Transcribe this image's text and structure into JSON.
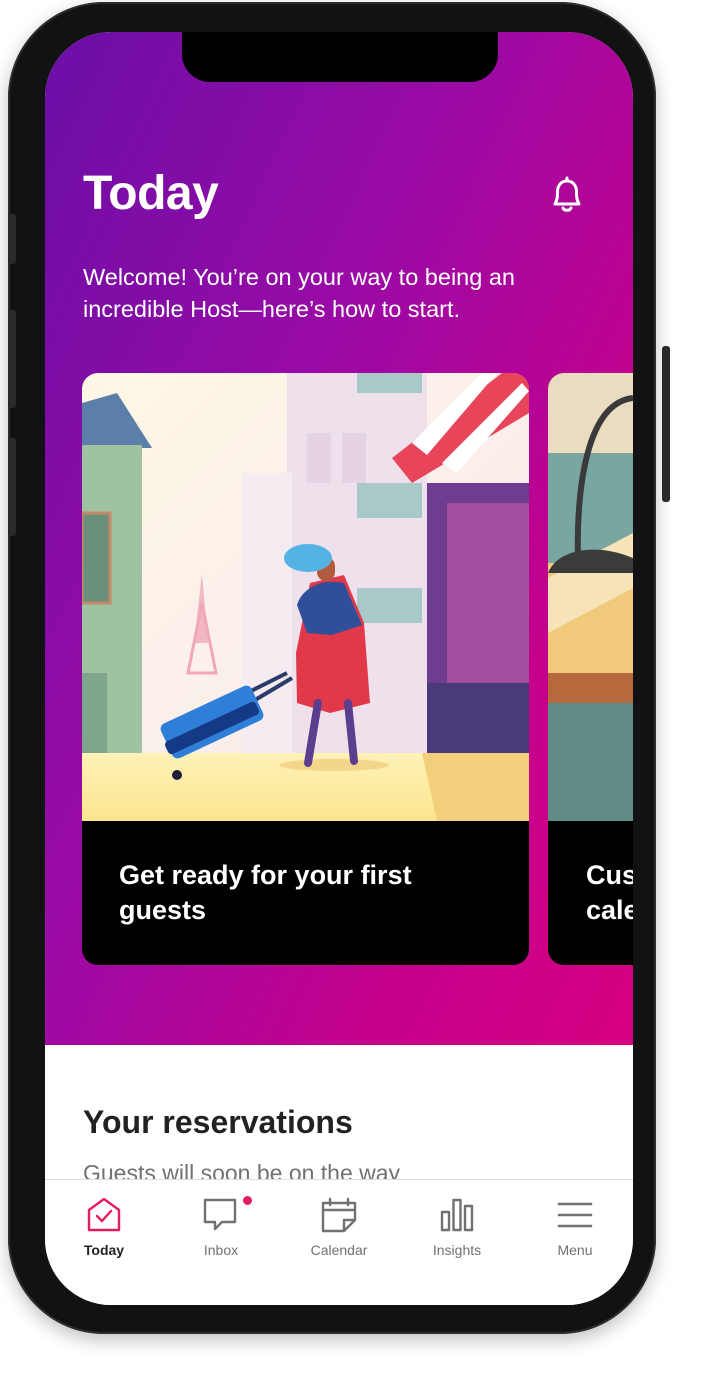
{
  "header": {
    "title": "Today"
  },
  "welcome": {
    "text": "Welcome! You’re on your way to being an incredible Host—here’s how to start."
  },
  "cards": [
    {
      "title": "Get ready for your first guests"
    },
    {
      "title": "Cus\ncale"
    }
  ],
  "reservations": {
    "title": "Your reservations",
    "subtitle": "Guests will soon be on the way"
  },
  "tabbar": {
    "tabs": [
      {
        "label": "Today",
        "icon": "home-check-icon",
        "active": true
      },
      {
        "label": "Inbox",
        "icon": "chat-bubble-icon",
        "active": false,
        "has_notification": true
      },
      {
        "label": "Calendar",
        "icon": "calendar-icon",
        "active": false
      },
      {
        "label": "Insights",
        "icon": "bar-chart-icon",
        "active": false
      },
      {
        "label": "Menu",
        "icon": "menu-icon",
        "active": false
      }
    ]
  },
  "colors": {
    "accent": "#e31c5f",
    "hero_gradient": [
      "#6a0fa6",
      "#d70082"
    ],
    "text_dark": "#222222",
    "text_muted": "#717171"
  }
}
